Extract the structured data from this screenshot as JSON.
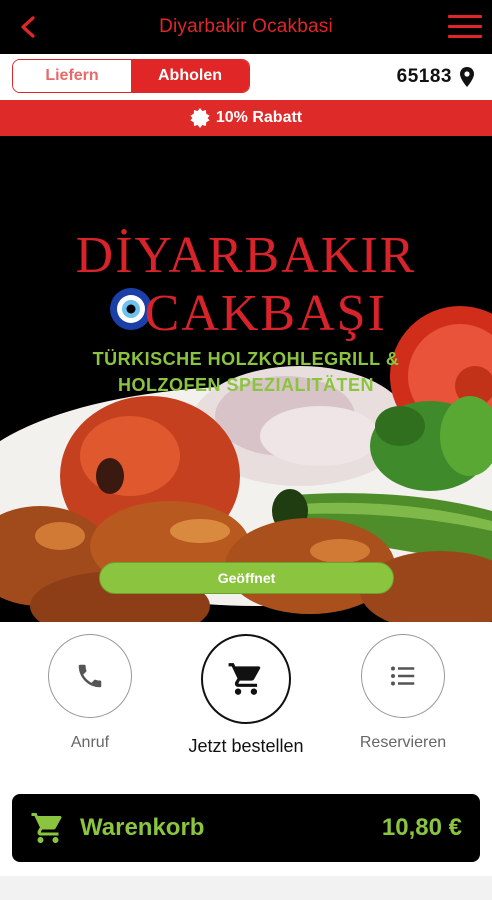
{
  "header": {
    "title": "Diyarbakir Ocakbasi"
  },
  "mode": {
    "delivery_label": "Liefern",
    "pickup_label": "Abholen",
    "selected": "pickup",
    "zip": "65183"
  },
  "discount": {
    "label": "10% Rabatt"
  },
  "hero": {
    "brand_line1": "DİYARBAKIR",
    "brand_line2_lead": "O",
    "brand_line2_rest": "CAKBAŞI",
    "tagline_line1": "TÜRKISCHE HOLZKOHLEGRILL &",
    "tagline_line2": "HOLZOFEN SPEZIALITÄTEN",
    "status": "Geöffnet"
  },
  "actions": {
    "call_label": "Anruf",
    "order_label": "Jetzt bestellen",
    "reserve_label": "Reservieren"
  },
  "cart": {
    "label": "Warenkorb",
    "total": "10,80 €"
  },
  "colors": {
    "brand_red": "#e02626",
    "accent_green": "#8bc53f",
    "header_bg": "#000000"
  },
  "icons": {
    "back": "chevron-left-icon",
    "menu": "hamburger-menu-icon",
    "location": "location-pin-icon",
    "discount": "badge-icon",
    "call": "phone-icon",
    "order": "cart-icon",
    "reserve": "list-icon",
    "cart": "cart-icon"
  }
}
